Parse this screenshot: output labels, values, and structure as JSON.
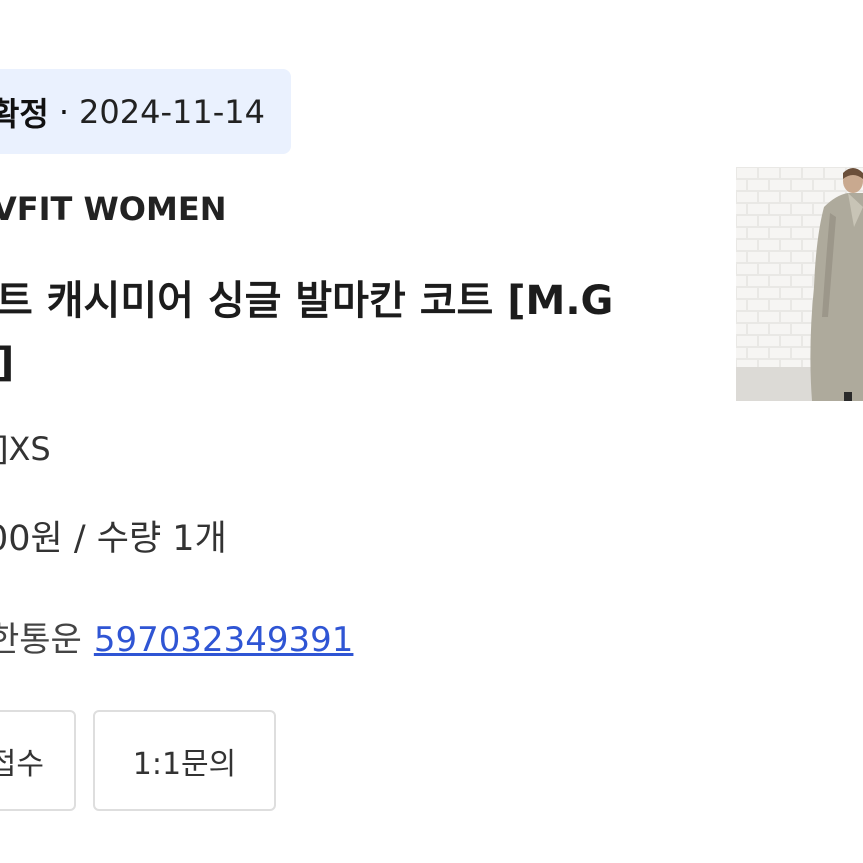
{
  "order": {
    "status": "확정",
    "separator": "·",
    "date": "2024-11-14"
  },
  "product": {
    "brand": "VFIT WOMEN",
    "title_line1": "트 캐시미어 싱글 발마칸 코트 [M.G",
    "title_line2": "]",
    "option": "]XS",
    "price_quantity": "00원 / 수량 1개"
  },
  "tracking": {
    "label": "한통운",
    "number": "597032349391"
  },
  "actions": {
    "return_label": "접수",
    "inquiry_label": "1:1문의"
  },
  "image": {
    "subject": "model wearing beige long coat in front of white brick wall"
  }
}
